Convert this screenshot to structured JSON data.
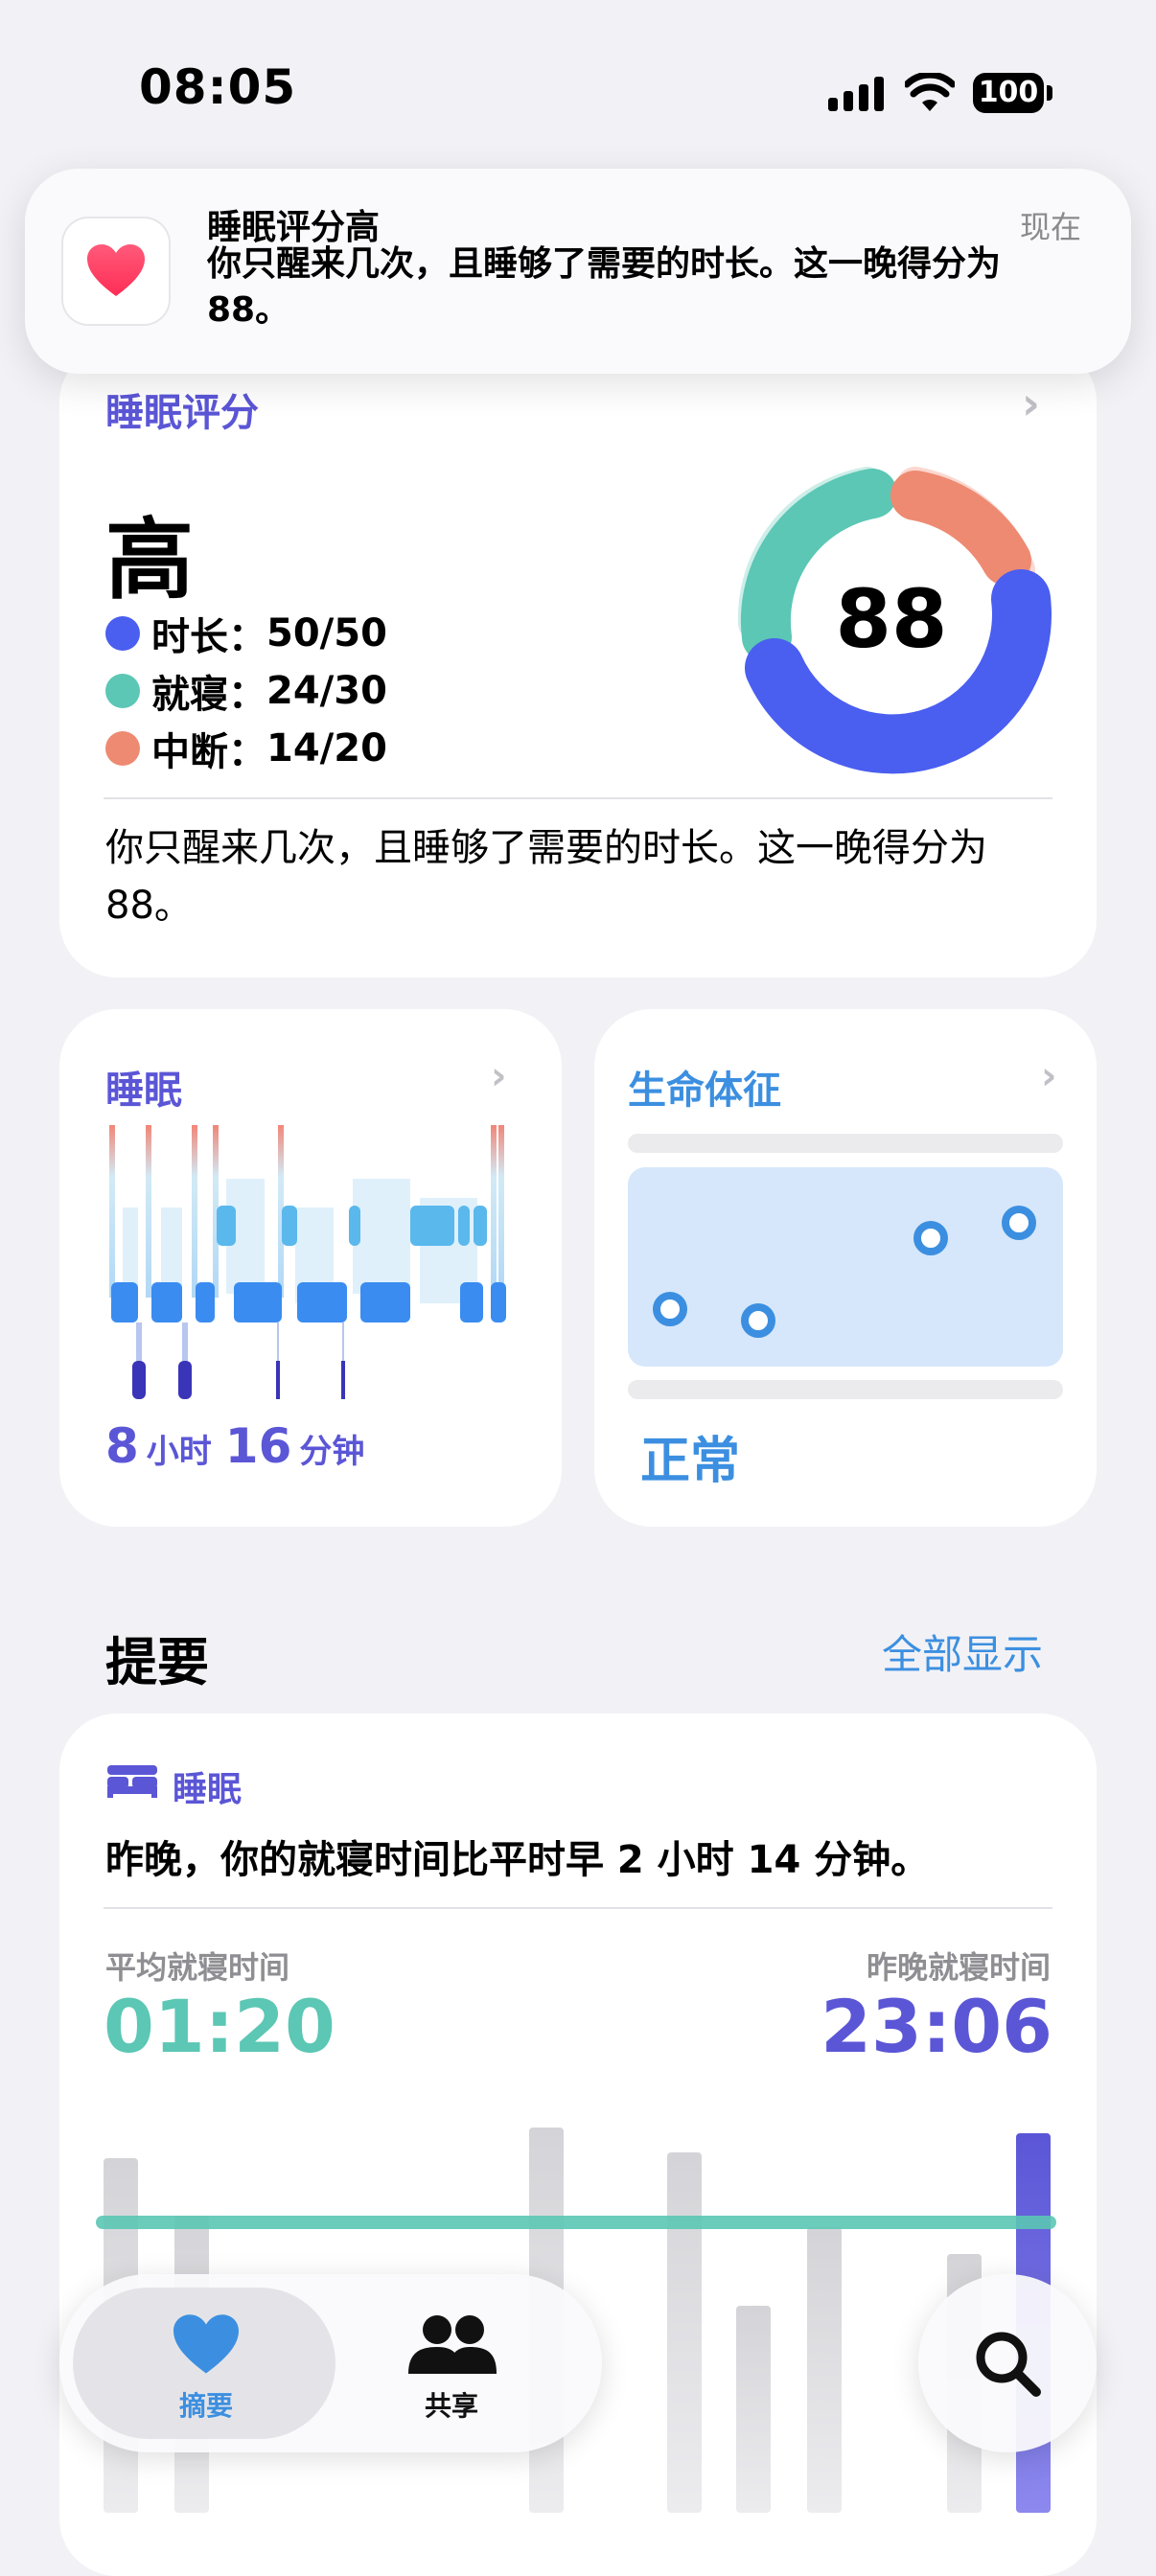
{
  "status_bar": {
    "time": "08:05",
    "battery": "100"
  },
  "notification": {
    "app_icon": "heart-icon",
    "title": "睡眠评分高",
    "body": "你只醒来几次，且睡够了需要的时长。这一晚得分为88。",
    "time": "现在"
  },
  "sleep_score": {
    "section_title": "睡眠评分",
    "level": "高",
    "score": "88",
    "components": [
      {
        "label": "时长：",
        "value": "50/50",
        "color": "#4a5ef0"
      },
      {
        "label": "就寝：",
        "value": "24/30",
        "color": "#5bc7b4"
      },
      {
        "label": "中断：",
        "value": "14/20",
        "color": "#ee8a72"
      }
    ],
    "description": "你只醒来几次，且睡够了需要的时长。这一晚得分为88。"
  },
  "sleep_tile": {
    "title": "睡眠",
    "hours": "8",
    "hours_unit": "小时",
    "minutes": "16",
    "minutes_unit": "分钟"
  },
  "vitals_tile": {
    "title": "生命体征",
    "status": "正常"
  },
  "highlights": {
    "title": "提要",
    "show_all": "全部显示",
    "card": {
      "category": "睡眠",
      "headline": "昨晚，你的就寝时间比平时早 2 小时 14 分钟。",
      "avg_label": "平均就寝时间",
      "avg_value": "01:20",
      "last_label": "昨晚就寝时间",
      "last_value": "23:06",
      "accent_teal": "#5bc7b4",
      "accent_purple": "#5b56d6"
    }
  },
  "tab_bar": {
    "tabs": [
      {
        "label": "摘要",
        "icon": "heart-icon",
        "active": true
      },
      {
        "label": "共享",
        "icon": "people-icon",
        "active": false
      }
    ],
    "search_icon": "search-icon"
  }
}
